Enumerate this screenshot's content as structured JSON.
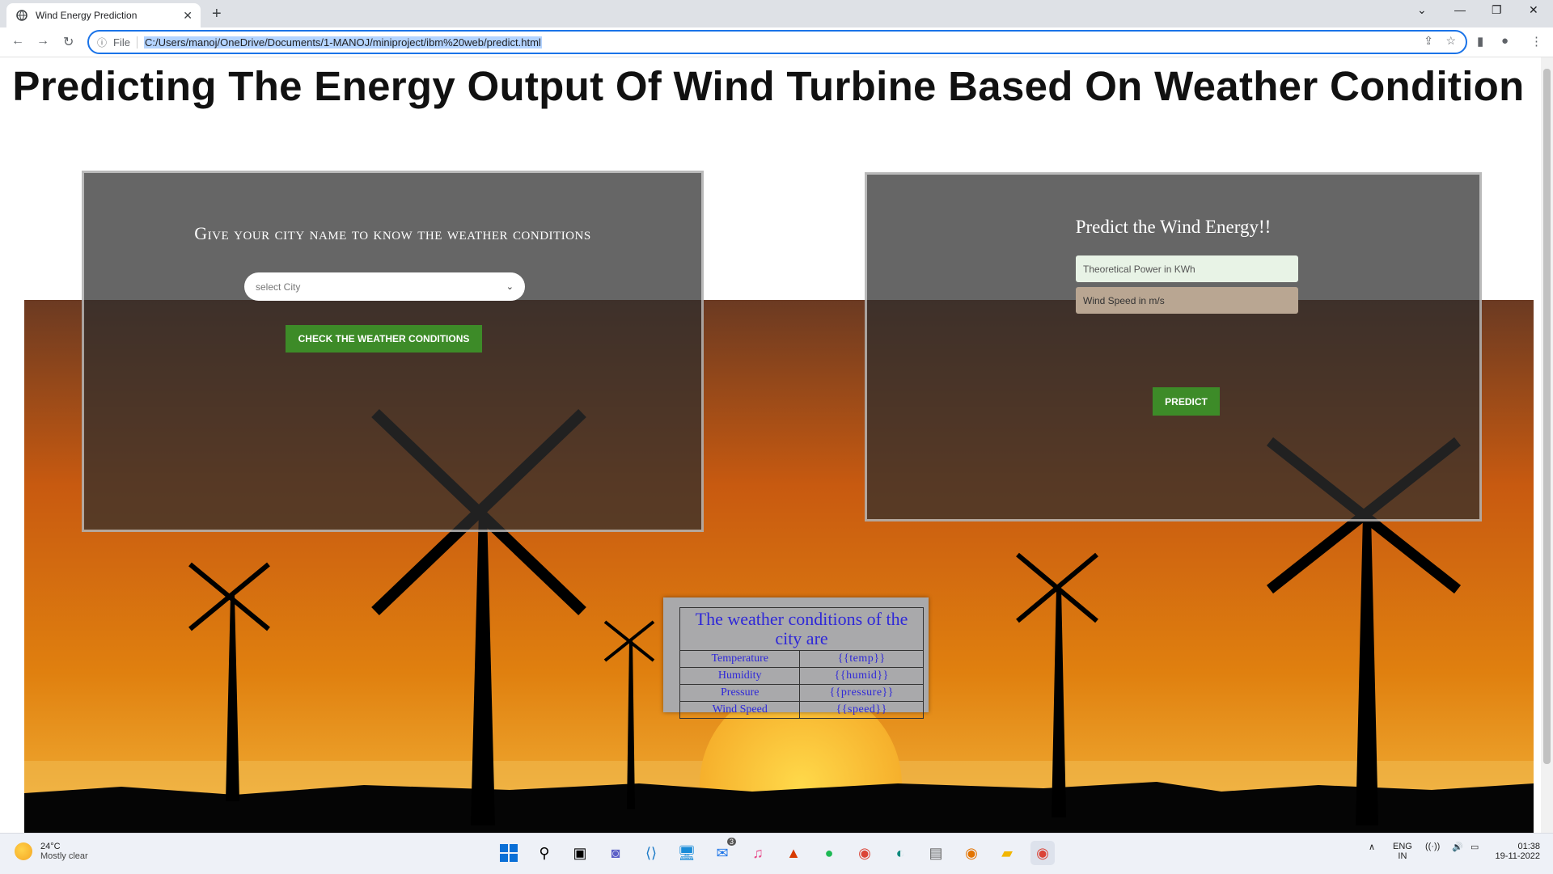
{
  "browser": {
    "tab_title": "Wind Energy Prediction",
    "scheme": "File",
    "url": "C:/Users/manoj/OneDrive/Documents/1-MANOJ/miniproject/ibm%20web/predict.html"
  },
  "page": {
    "heading": "Predicting The Energy Output Of Wind Turbine Based On Weather Condition"
  },
  "left_panel": {
    "title": "Give your city name to know the weather conditions",
    "select_placeholder": "select City",
    "check_button": "Check the weather conditions"
  },
  "right_panel": {
    "title": "Predict the Wind Energy!!",
    "power_placeholder": "Theoretical Power in KWh",
    "speed_placeholder": "Wind Speed in m/s",
    "predict_button": "Predict"
  },
  "weather_table": {
    "title": "The weather conditions of the city are",
    "rows": [
      {
        "label": "Temperature",
        "value": "{{temp}}"
      },
      {
        "label": "Humidity",
        "value": "{{humid}}"
      },
      {
        "label": "Pressure",
        "value": "{{pressure}}"
      },
      {
        "label": "Wind Speed",
        "value": "{{speed}}"
      }
    ]
  },
  "taskbar": {
    "temperature": "24°C",
    "condition": "Mostly clear",
    "language": "ENG",
    "region": "IN",
    "time": "01:38",
    "date": "19-11-2022",
    "mail_badge": "3"
  },
  "colors": {
    "sky_top": "#6b3a22",
    "sky_mid": "#d35a10",
    "sky_bottom": "#f0a030",
    "button_green": "#3d8b28",
    "table_text": "#2f28d8"
  }
}
